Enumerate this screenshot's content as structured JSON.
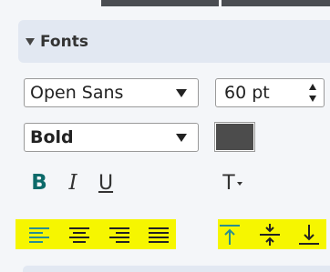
{
  "panel": {
    "title": "Fonts"
  },
  "font_family": {
    "value": "Open Sans"
  },
  "font_size": {
    "value": "60 pt"
  },
  "font_weight": {
    "value": "Bold"
  },
  "font_color": {
    "hex": "#4c4c4c"
  },
  "style_buttons": {
    "bold": "B",
    "italic": "I",
    "underline": "U",
    "transform": "T"
  },
  "colors": {
    "accent_bold": "#0c6a6a",
    "accent_active": "#2a8f8f",
    "highlight": "#f6f600"
  },
  "icons": {
    "alignment": [
      "align-left-icon",
      "align-center-icon",
      "align-right-icon",
      "align-justify-icon"
    ],
    "vertical": [
      "align-top-icon",
      "align-middle-icon",
      "align-bottom-icon"
    ],
    "states": {
      "align_left_active": true,
      "align_top_active": true
    }
  }
}
